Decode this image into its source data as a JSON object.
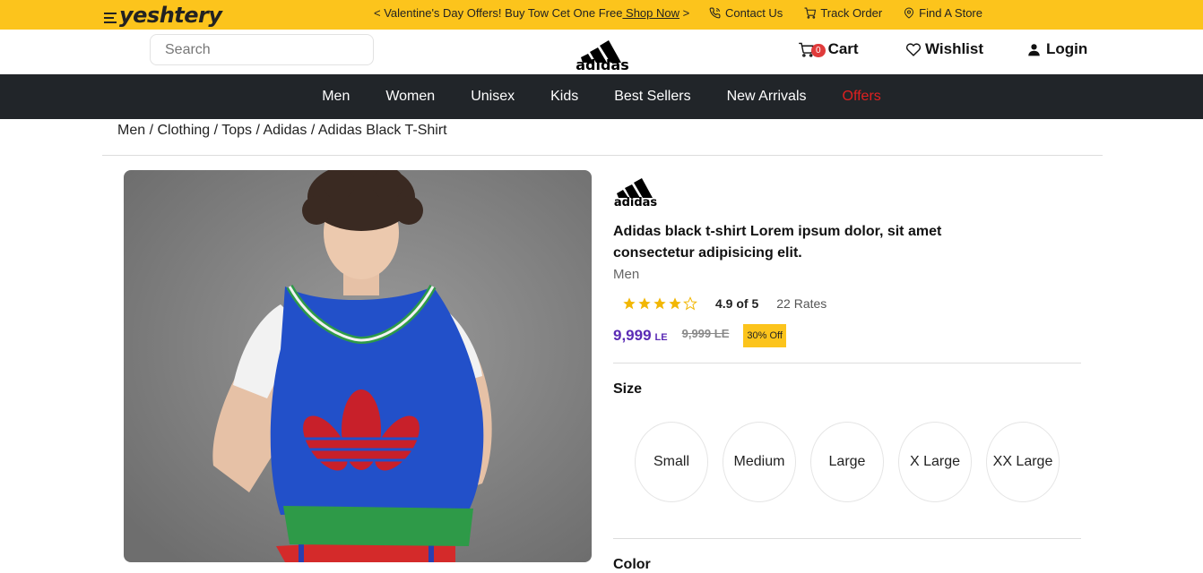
{
  "topbar": {
    "brand": "yeshtery",
    "promo_text": "< Valentine's Day Offers! Buy Tow Cet One Free",
    "promo_link": " Shop Now",
    "promo_suffix": " >",
    "links": [
      {
        "label": "Contact Us",
        "icon": "phone-icon"
      },
      {
        "label": "Track Order",
        "icon": "cart-icon"
      },
      {
        "label": "Find A Store",
        "icon": "location-pin-icon"
      }
    ]
  },
  "header": {
    "search_placeholder": "Search",
    "logo_text": "adidas",
    "cart_count": "0",
    "cart_label": "Cart",
    "wishlist_label": "Wishlist",
    "login_label": "Login"
  },
  "nav": {
    "items": [
      "Men",
      "Women",
      "Unisex",
      "Kids",
      "Best Sellers",
      "New Arrivals",
      "Offers"
    ]
  },
  "breadcrumb": [
    "Men",
    "Clothing",
    "Tops",
    "Adidas",
    "Adidas Black T-Shirt"
  ],
  "product": {
    "brand_logo_text": "adidas",
    "title": "Adidas black t-shirt Lorem ipsum dolor, sit amet consectetur adipisicing elit.",
    "category": "Men",
    "rating_stars": 4,
    "rating_value": "4.9 of 5",
    "rating_count": "22 Rates",
    "price": "9,999",
    "currency": "LE",
    "old_price": "9,999 LE",
    "discount": "30% Off",
    "size_label": "Size",
    "sizes": [
      "Small",
      "Medium",
      "Large",
      "X Large",
      "XX Large"
    ],
    "color_label": "Color"
  },
  "colors": {
    "topbar": "#fcc41c",
    "nav": "#212529",
    "price": "#5b2bb5",
    "offers": "#e02020",
    "star": "#f2b705"
  }
}
